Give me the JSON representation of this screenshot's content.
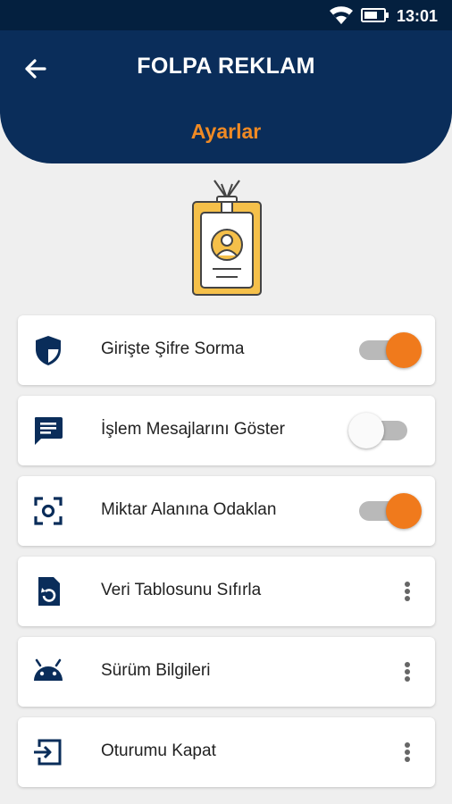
{
  "status_bar": {
    "time": "13:01",
    "icons": [
      "wifi-icon",
      "battery-icon"
    ]
  },
  "header": {
    "title": "FOLPA REKLAM",
    "subtitle": "Ayarlar",
    "back_icon": "arrow-back-icon"
  },
  "illustration": {
    "icon": "id-badge-icon"
  },
  "settings": [
    {
      "label": "Girişte Şifre Sorma",
      "icon": "shield-icon",
      "control": "toggle",
      "state": "on"
    },
    {
      "label": "İşlem Mesajlarını Göster",
      "icon": "message-icon",
      "control": "toggle",
      "state": "off"
    },
    {
      "label": "Miktar Alanına Odaklan",
      "icon": "focus-icon",
      "control": "toggle",
      "state": "on"
    },
    {
      "label": "Veri Tablosunu Sıfırla",
      "icon": "file-restore-icon",
      "control": "menu"
    },
    {
      "label": "Sürüm Bilgileri",
      "icon": "android-icon",
      "control": "menu"
    },
    {
      "label": "Oturumu Kapat",
      "icon": "logout-icon",
      "control": "menu"
    }
  ],
  "colors": {
    "header": "#0a2d5a",
    "status_bar": "#04203f",
    "accent": "#f07a1c",
    "subtitle": "#f08a24",
    "icon": "#0a2d5a",
    "background": "#efefef"
  }
}
